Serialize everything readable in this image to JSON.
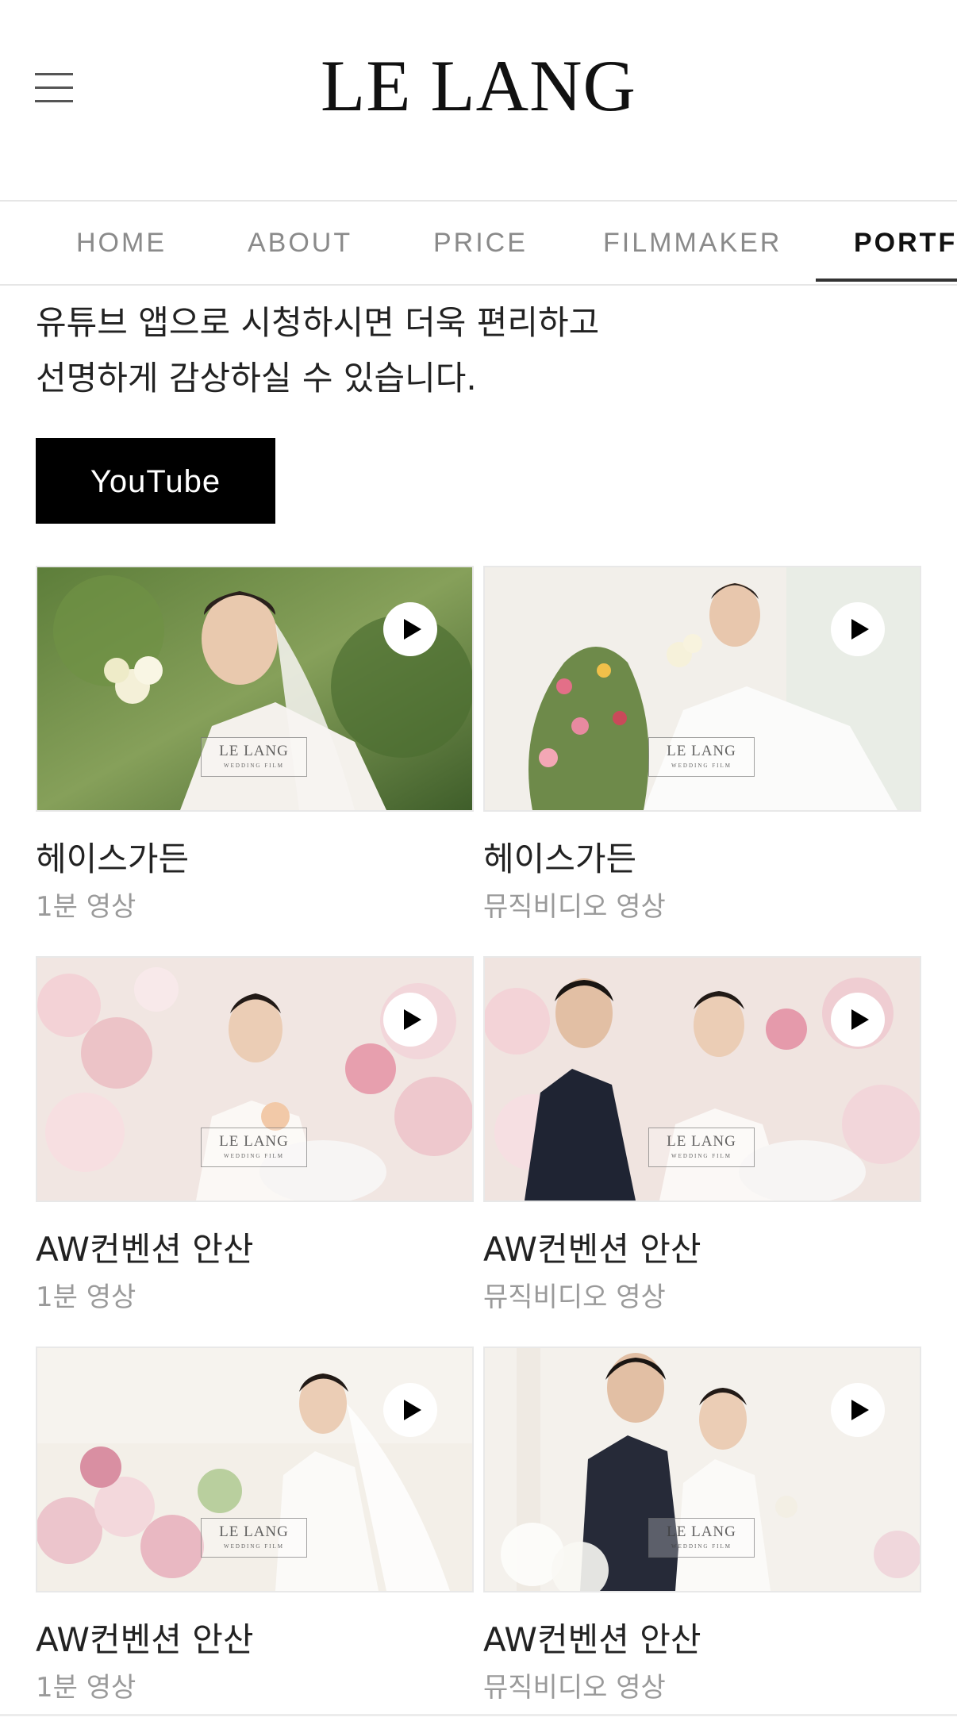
{
  "header": {
    "logo": "LE LANG",
    "menu_icon": "hamburger-menu-icon"
  },
  "nav": {
    "items": [
      {
        "label": "HOME",
        "active": false
      },
      {
        "label": "ABOUT",
        "active": false
      },
      {
        "label": "PRICE",
        "active": false
      },
      {
        "label": "FILMMAKER",
        "active": false
      },
      {
        "label": "PORTF",
        "active": true
      }
    ]
  },
  "intro": {
    "line1": "유튜브 앱으로 시청하시면 더욱 편리하고",
    "line2": "선명하게 감상하실 수 있습니다."
  },
  "youtube_button": {
    "label": "YouTube"
  },
  "watermark": {
    "main": "LE LANG",
    "sub": "WEDDING FILM"
  },
  "videos": [
    {
      "title": "헤이스가든",
      "subtitle": "1분 영상",
      "icon": "play-icon"
    },
    {
      "title": "헤이스가든",
      "subtitle": "뮤직비디오 영상",
      "icon": "play-icon"
    },
    {
      "title": "AW컨벤션 안산",
      "subtitle": "1분 영상",
      "icon": "play-icon"
    },
    {
      "title": "AW컨벤션 안산",
      "subtitle": "뮤직비디오 영상",
      "icon": "play-icon"
    },
    {
      "title": "AW컨벤션 안산",
      "subtitle": "1분 영상",
      "icon": "play-icon"
    },
    {
      "title": "AW컨벤션 안산",
      "subtitle": "뮤직비디오 영상",
      "icon": "play-icon"
    }
  ],
  "colors": {
    "accent": "#000000",
    "nav_inactive": "#8a8a8a",
    "subtitle": "#9a9a9a"
  }
}
